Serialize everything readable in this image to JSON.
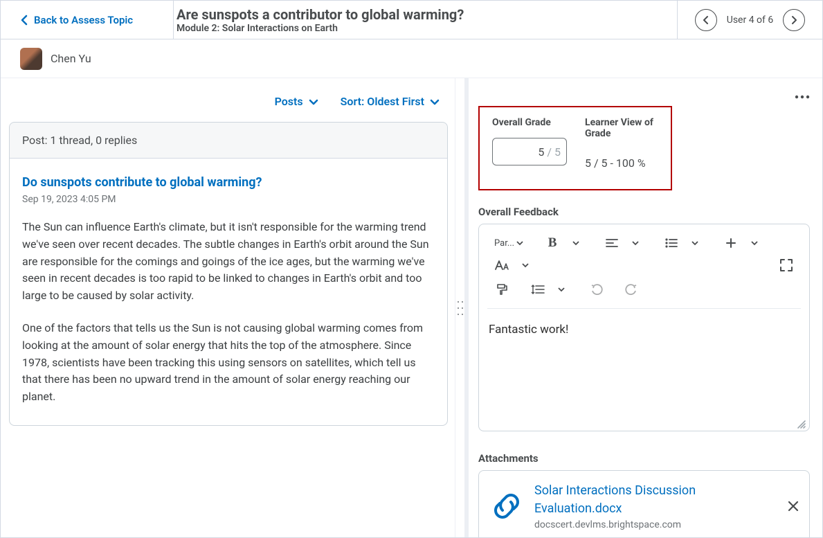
{
  "topbar": {
    "back_label": "Back to Assess Topic",
    "title": "Are sunspots a contributor to global warming?",
    "subtitle": "Module 2: Solar Interactions on Earth",
    "pager_label": "User 4 of 6"
  },
  "user": {
    "name": "Chen Yu"
  },
  "controls": {
    "posts_label": "Posts",
    "sort_label": "Sort: Oldest First"
  },
  "post": {
    "count_line": "Post: 1 thread, 0 replies",
    "title": "Do sunspots contribute to global warming?",
    "timestamp": "Sep 19, 2023 4:05 PM",
    "paragraph1": "The Sun can influence Earth's climate, but it isn't responsible for the warming trend we've seen over recent decades. The subtle changes in Earth's orbit around the Sun are responsible for the comings and goings of the ice ages, but the warming we've seen in recent decades is too rapid to be linked to changes in Earth's orbit and too large to be caused by solar activity.",
    "paragraph2": "One of the factors that tells us the Sun is not causing global warming comes from looking at the amount of solar energy that hits the top of the atmosphere. Since 1978, scientists have been tracking this using sensors on satellites, which tell us that there has been no upward trend in the amount of solar energy reaching our planet."
  },
  "grade": {
    "overall_label": "Overall Grade",
    "learner_label": "Learner View of Grade",
    "value": "5",
    "max": "5",
    "learner_view": "5 / 5 - 100 %"
  },
  "feedback": {
    "section_label": "Overall Feedback",
    "paragraph_style_label": "Par...",
    "content": "Fantastic work!"
  },
  "attachments": {
    "section_label": "Attachments",
    "file_name": "Solar Interactions Discussion Evaluation.docx",
    "file_domain": "docscert.devlms.brightspace.com"
  }
}
